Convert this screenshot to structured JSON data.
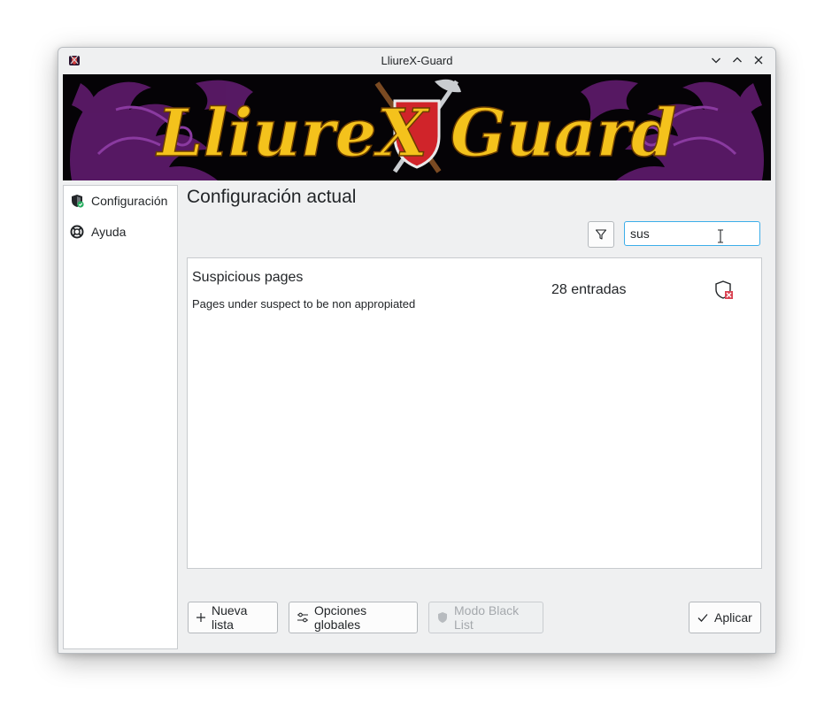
{
  "window": {
    "title": "LliureX-Guard",
    "controls": [
      "minimize",
      "maximize",
      "close"
    ]
  },
  "banner": {
    "logo_text": "LliureX Guard"
  },
  "sidebar": {
    "items": [
      {
        "label": "Configuración",
        "icon": "shield-check-icon",
        "selected": true
      },
      {
        "label": "Ayuda",
        "icon": "lifebuoy-icon",
        "selected": false
      }
    ]
  },
  "main": {
    "title": "Configuración actual",
    "search": {
      "value": "sus",
      "placeholder": ""
    }
  },
  "lists": [
    {
      "name": "Suspicious pages",
      "description": "Pages under suspect to be non appropiated",
      "entries": "28 entradas",
      "status_icon": "shield-blocked-icon"
    }
  ],
  "buttons": {
    "new_list": "Nueva lista",
    "global_options": "Opciones globales",
    "mode": "Modo Black List",
    "apply": "Aplicar"
  },
  "colors": {
    "accent": "#3daee9",
    "banner_dragon": "#6a1f7a",
    "logo_gold": "#f4c21c",
    "blocked_red": "#da4453",
    "check_green": "#27ae60"
  }
}
